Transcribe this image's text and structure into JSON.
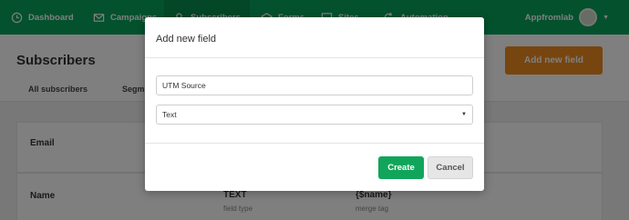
{
  "nav": {
    "items": [
      {
        "label": "Dashboard",
        "icon": "clock-icon"
      },
      {
        "label": "Campaigns",
        "icon": "envelope-icon"
      },
      {
        "label": "Subscribers",
        "icon": "user-icon"
      },
      {
        "label": "Forms",
        "icon": "layers-icon"
      },
      {
        "label": "Sites",
        "icon": "monitor-icon"
      },
      {
        "label": "Automation",
        "icon": "refresh-icon"
      }
    ],
    "account_name": "Appfromlab"
  },
  "page": {
    "title": "Subscribers",
    "add_field_button": "Add new field",
    "tabs": [
      "All subscribers",
      "Segm"
    ]
  },
  "fields_table": {
    "rows": [
      {
        "label": "Email"
      },
      {
        "label": "Name",
        "type": "TEXT",
        "type_caption": "field type",
        "tag": "{$name}",
        "tag_caption": "merge tag"
      }
    ]
  },
  "modal": {
    "title": "Add new field",
    "name_value": "UTM Source",
    "type_selected": "Text",
    "create_label": "Create",
    "cancel_label": "Cancel"
  },
  "colors": {
    "brand_green": "#09a35a",
    "accent_orange": "#ee8b1f",
    "create_green": "#11a55b"
  }
}
